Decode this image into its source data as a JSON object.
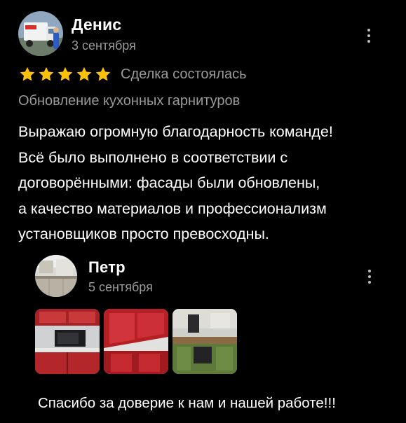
{
  "review": {
    "author": "Денис",
    "date": "3 сентября",
    "rating": 5,
    "rating_max": 5,
    "deal_status": "Сделка состоялась",
    "service": "Обновление кухонных гарнитуров",
    "text_lines": [
      "Выражаю огромную благодарность команде!",
      "Всё было выполнено в соответствии с",
      "договорёнными: фасады были обновлены,",
      "а качество материалов и профессионализм",
      "установщиков просто превосходны."
    ]
  },
  "reply": {
    "author": "Петр",
    "date": "5 сентября",
    "photos": [
      "kitchen-photo-red-microwave",
      "kitchen-photo-red-cabinets",
      "kitchen-photo-green-kitchen"
    ],
    "text": "Спасибо за доверие к нам и нашей работе!!!"
  },
  "colors": {
    "background": "#000000",
    "star": "#f9c10a",
    "secondary_text": "#9a9a9a"
  },
  "icons": [
    "avatar-truck",
    "star-icon",
    "more-vert-icon",
    "avatar-kitchen"
  ]
}
